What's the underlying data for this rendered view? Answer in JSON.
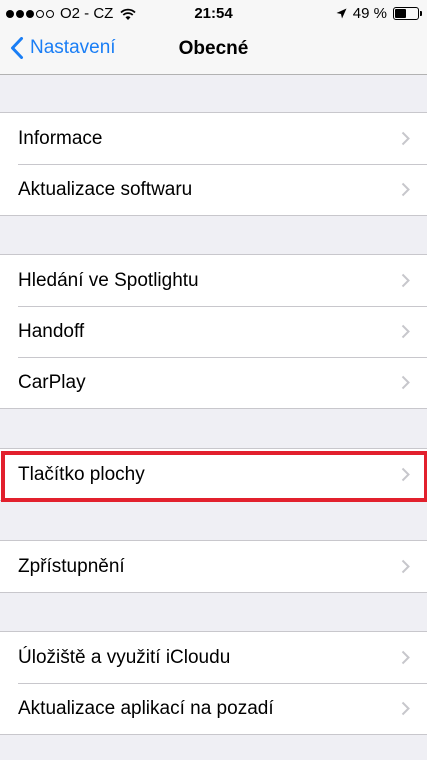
{
  "status_bar": {
    "carrier": "O2 - CZ",
    "time": "21:54",
    "battery_percent": "49 %",
    "battery_level": 0.49
  },
  "nav": {
    "back_label": "Nastavení",
    "title": "Obecné",
    "accent_color": "#1a7ef5"
  },
  "groups": [
    {
      "items": [
        {
          "label": "Informace"
        },
        {
          "label": "Aktualizace softwaru"
        }
      ]
    },
    {
      "items": [
        {
          "label": "Hledání ve Spotlightu"
        },
        {
          "label": "Handoff"
        },
        {
          "label": "CarPlay"
        }
      ]
    },
    {
      "items": [
        {
          "label": "Tlačítko plochy"
        }
      ]
    },
    {
      "items": [
        {
          "label": "Zpřístupnění"
        }
      ]
    },
    {
      "items": [
        {
          "label": "Úložiště a využití iCloudu"
        },
        {
          "label": "Aktualizace aplikací na pozadí"
        }
      ]
    }
  ],
  "highlight_color": "#e2202d"
}
